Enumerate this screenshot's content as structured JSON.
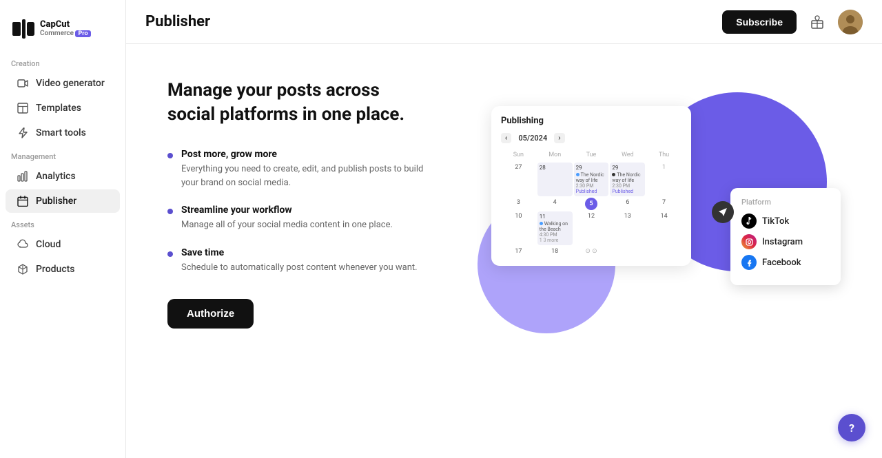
{
  "logo": {
    "brand": "CapCut",
    "product": "Commerce",
    "badge": "Pro"
  },
  "sidebar": {
    "creation_label": "Creation",
    "creation_items": [
      {
        "id": "video-generator",
        "label": "Video generator",
        "icon": "video"
      },
      {
        "id": "templates",
        "label": "Templates",
        "icon": "layout"
      },
      {
        "id": "smart-tools",
        "label": "Smart tools",
        "icon": "zap"
      }
    ],
    "management_label": "Management",
    "management_items": [
      {
        "id": "analytics",
        "label": "Analytics",
        "icon": "bar-chart"
      },
      {
        "id": "publisher",
        "label": "Publisher",
        "icon": "calendar",
        "active": true
      }
    ],
    "assets_label": "Assets",
    "assets_items": [
      {
        "id": "cloud",
        "label": "Cloud",
        "icon": "cloud"
      },
      {
        "id": "products",
        "label": "Products",
        "icon": "box"
      }
    ]
  },
  "header": {
    "title": "Publisher",
    "subscribe_label": "Subscribe"
  },
  "main": {
    "headline": "Manage your posts across social platforms in one place.",
    "features": [
      {
        "title": "Post more, grow more",
        "desc": "Everything you need to create, edit, and publish posts to build your brand on social media."
      },
      {
        "title": "Streamline your workflow",
        "desc": "Manage all of your social media content in one place."
      },
      {
        "title": "Save time",
        "desc": "Schedule to automatically post content whenever you want."
      }
    ],
    "authorize_label": "Authorize"
  },
  "illustration": {
    "card_title": "Publishing",
    "month": "05/2024",
    "days": [
      "Sunday",
      "Monday",
      "Tuesday",
      "Wednesday"
    ],
    "platform_title": "Platform",
    "platforms": [
      "TikTok",
      "Instagram",
      "Facebook"
    ]
  },
  "help": {
    "label": "?"
  }
}
